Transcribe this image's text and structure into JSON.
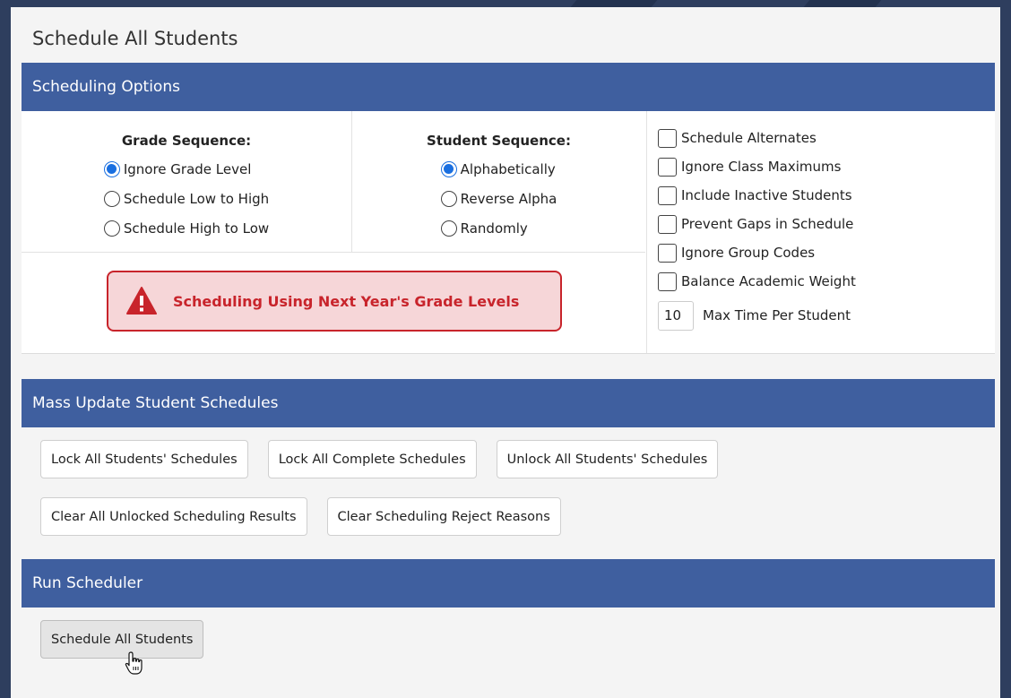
{
  "title": "Schedule All Students",
  "scheduling_options": {
    "header": "Scheduling Options",
    "grade_sequence": {
      "title": "Grade Sequence:",
      "options": [
        {
          "label": "Ignore Grade Level",
          "selected": true
        },
        {
          "label": "Schedule Low to High",
          "selected": false
        },
        {
          "label": "Schedule High to Low",
          "selected": false
        }
      ]
    },
    "student_sequence": {
      "title": "Student Sequence:",
      "options": [
        {
          "label": "Alphabetically",
          "selected": true
        },
        {
          "label": "Reverse Alpha",
          "selected": false
        },
        {
          "label": "Randomly",
          "selected": false
        }
      ]
    },
    "warning": {
      "text": "Scheduling Using Next Year's Grade Levels",
      "icon": "warning-triangle-icon"
    },
    "checkboxes": [
      {
        "label": "Schedule Alternates",
        "checked": false
      },
      {
        "label": "Ignore Class Maximums",
        "checked": false
      },
      {
        "label": "Include Inactive Students",
        "checked": false
      },
      {
        "label": "Prevent Gaps in Schedule",
        "checked": false
      },
      {
        "label": "Ignore Group Codes",
        "checked": false
      },
      {
        "label": "Balance Academic Weight",
        "checked": false
      }
    ],
    "max_time": {
      "value": "10",
      "label": "Max Time Per Student"
    }
  },
  "mass_update": {
    "header": "Mass Update Student Schedules",
    "buttons_row1": [
      "Lock All Students' Schedules",
      "Lock All Complete Schedules",
      "Unlock All Students' Schedules"
    ],
    "buttons_row2": [
      "Clear All Unlocked Scheduling Results",
      "Clear Scheduling Reject Reasons"
    ]
  },
  "run_scheduler": {
    "header": "Run Scheduler",
    "button": "Schedule All Students"
  },
  "colors": {
    "header_bg": "#3f5f9f",
    "warning": "#c8242b",
    "radio_selected": "#1a6fe0"
  }
}
